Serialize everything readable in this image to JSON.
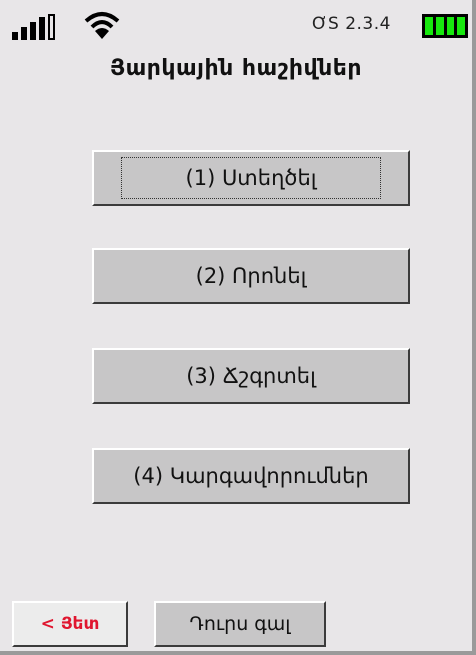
{
  "status_bar": {
    "signal_icon": "signal-strength-icon",
    "wifi_icon": "wifi-icon",
    "version": "ƠS 2.3.4",
    "battery_icon": "battery-full-icon",
    "battery_color": "#17e80e"
  },
  "header": {
    "title": "Յարկային հաշիվներ"
  },
  "menu": {
    "items": [
      {
        "label": "(1) Ստեղծել",
        "focused": true
      },
      {
        "label": "(2) Որոնել",
        "focused": false
      },
      {
        "label": "(3) Ճշգրտել",
        "focused": false
      },
      {
        "label": "(4) Կարգավորումներ",
        "focused": false
      }
    ]
  },
  "softkeys": {
    "back_label": "< Յետ",
    "back_color": "#e0162f",
    "exit_label": "Դուրս գալ"
  }
}
